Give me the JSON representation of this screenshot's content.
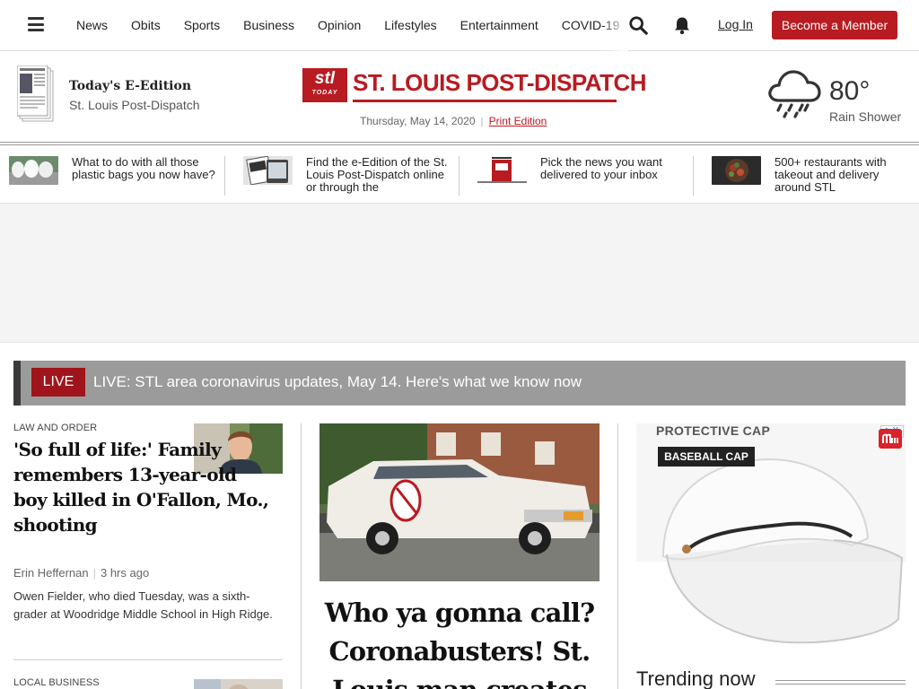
{
  "nav": {
    "items": [
      "News",
      "Obits",
      "Sports",
      "Business",
      "Opinion",
      "Lifestyles",
      "Entertainment",
      "COVID-19"
    ],
    "login": "Log In",
    "member": "Become a Member"
  },
  "edition": {
    "title": "Today's E-Edition",
    "subtitle": "St. Louis Post-Dispatch"
  },
  "logo": {
    "box_line1": "stl",
    "box_line2": "TODAY",
    "name": "ST. LOUIS POST-DISPATCH"
  },
  "dateline": {
    "date": "Thursday, May 14, 2020",
    "print": "Print Edition"
  },
  "weather": {
    "temp": "80°",
    "condition": "Rain Shower",
    "icon": "rain-cloud-icon"
  },
  "promos": [
    {
      "text": "What to do with all those plastic bags you now have?"
    },
    {
      "text": "Find the e-Edition of the St. Louis Post-Dispatch online or through the"
    },
    {
      "text": "Pick the news you want delivered to your inbox"
    },
    {
      "text": "500+ restaurants with takeout and delivery around STL"
    }
  ],
  "live": {
    "badge": "LIVE",
    "text": "LIVE: STL area coronavirus updates, May 14. Here's what we know now"
  },
  "left": {
    "kicker": "LAW AND ORDER",
    "headline": "'So full of life:' Family remembers 13-year-old boy killed in O'Fallon, Mo., shooting",
    "author": "Erin Heffernan",
    "time": "3 hrs ago",
    "summary": "Owen Fielder, who died Tuesday, was a sixth-grader at Woodridge Middle School in High Ridge.",
    "kicker2": "LOCAL BUSINESS"
  },
  "center": {
    "headline": "Who ya gonna call? Coronabusters! St. Louis man creates"
  },
  "ad": {
    "title": "PROTECTIVE CAP",
    "tag": "BASEBALL CAP",
    "choices": "▷X"
  },
  "trending": {
    "label": "Trending now"
  },
  "colors": {
    "brand_red": "#b81b21",
    "live_red": "#a0151c",
    "live_bar": "#9b9b9b"
  }
}
